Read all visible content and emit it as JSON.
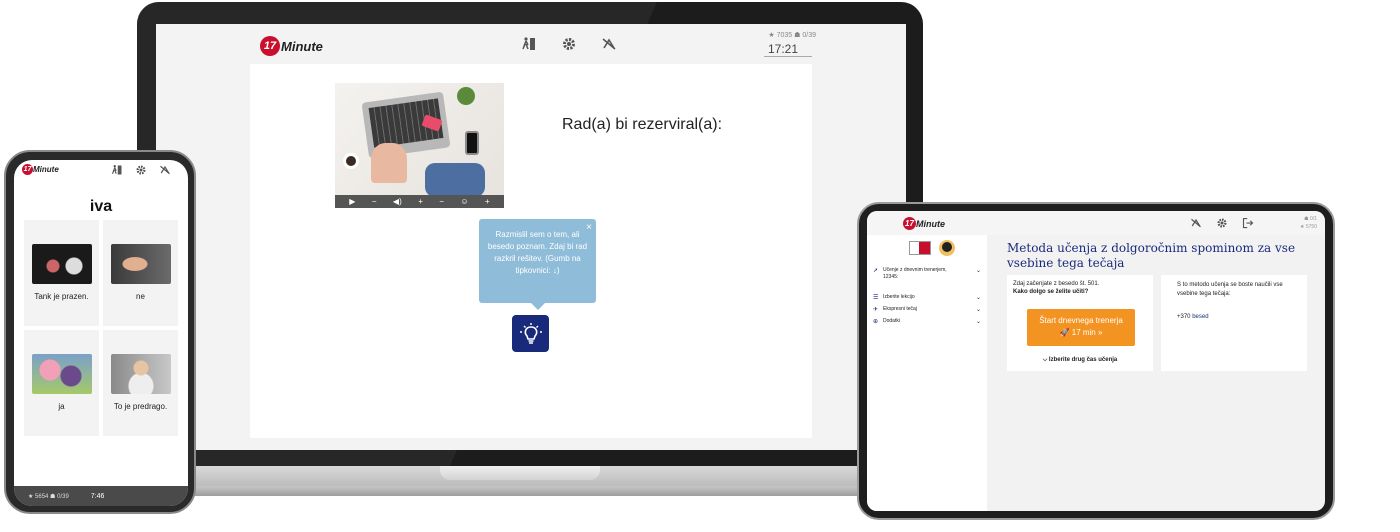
{
  "brand": {
    "logo_badge": "17",
    "logo_word": "Minute",
    "accent": "#c8102e",
    "navy": "#1a2a7a",
    "orange": "#f39322"
  },
  "laptop": {
    "stats": "★ 7035  ☗ 0/39",
    "time": "17:21",
    "prompt": "Rad(a) bi rezerviral(a):",
    "video_controls": [
      "▶",
      "−",
      "◀)",
      "+",
      "−",
      "☺",
      "+"
    ],
    "tooltip": {
      "text": "Razmislil sem o tem, ali besedo poznam. Zdaj bi rad razkril rešitev. (Gumb na tipkovnici: ↓)",
      "close": "×"
    },
    "icons": [
      "exit-icon",
      "gear-icon",
      "no-sound-icon",
      "lightbulb-icon"
    ]
  },
  "phone": {
    "title": "iva",
    "cells": [
      {
        "label": "Tank je prazen."
      },
      {
        "label": "ne"
      },
      {
        "label": "ja"
      },
      {
        "label": "To je predrago."
      }
    ],
    "footer_stats": "★ 5654  ☗ 0/39",
    "time": "7:46"
  },
  "tablet": {
    "stats_line1": "☗ 0/1",
    "stats_line2": "★ 5750",
    "sidebar": [
      {
        "icon": "rocket-icon",
        "label": "Učenje z dnevnim trenerjem, 12345:"
      },
      {
        "icon": "list-icon",
        "label": "Izberite lekcijo"
      },
      {
        "icon": "express-icon",
        "label": "Ekspresni tečaj"
      },
      {
        "icon": "extras-icon",
        "label": "Dodatki"
      }
    ],
    "main_title": "Metoda učenja z dolgoročnim spominom za vse vsebine tega tečaja",
    "card1_line": "Zdaj začenjate z besedo št. 501.",
    "card1_question": "Kako dolgo se želite učiti?",
    "start_button_line1": "Štart dnevnega trenerja",
    "start_button_line2": "🚀 17 min »",
    "alt_time": "⌵ Izberite drug čas učenja",
    "card2_text": "S to metodo učenja se boste naučili vse vsebine tega tečaja:",
    "card2_count": "+370",
    "card2_link": "besed"
  }
}
